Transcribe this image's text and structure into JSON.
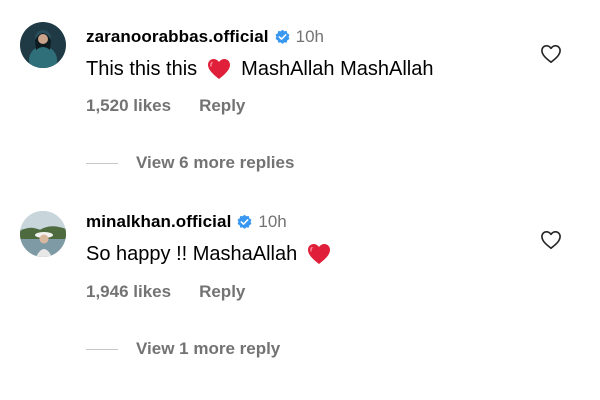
{
  "comments": [
    {
      "username": "zaranoorabbas.official",
      "time": "10h",
      "text_before": "This this this",
      "text_after": "MashAllah MashAllah",
      "likes": "1,520 likes",
      "reply_label": "Reply",
      "view_replies": "View 6 more replies"
    },
    {
      "username": "minalkhan.official",
      "time": "10h",
      "text_before": "So happy !! MashaAllah",
      "text_after": "",
      "likes": "1,946 likes",
      "reply_label": "Reply",
      "view_replies": "View 1 more reply"
    }
  ],
  "colors": {
    "verified": "#3897f0",
    "muted": "#737373",
    "heart_emoji": "#e0203a"
  },
  "icons": [
    "verified-badge-icon",
    "heart-outline-icon",
    "red-heart-emoji"
  ]
}
